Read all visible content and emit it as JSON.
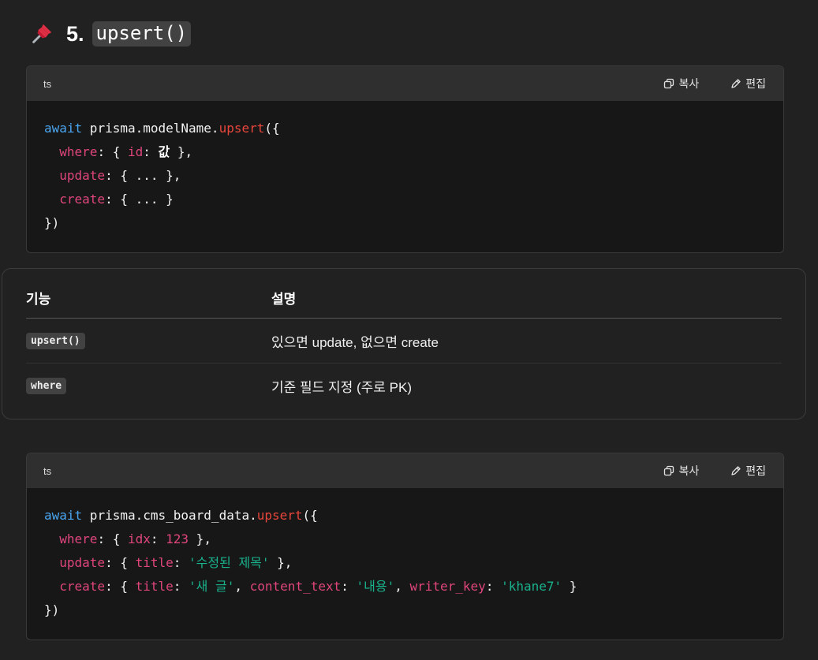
{
  "heading": {
    "number": "5.",
    "code": "upsert()"
  },
  "code_block_1": {
    "language": "ts",
    "copy_label": "복사",
    "edit_label": "편집",
    "lines": [
      [
        {
          "t": "await",
          "c": "kw"
        },
        {
          "t": " prisma.modelName.",
          "c": ""
        },
        {
          "t": "upsert",
          "c": "fn"
        },
        {
          "t": "({",
          "c": ""
        }
      ],
      [
        {
          "t": "  ",
          "c": ""
        },
        {
          "t": "where",
          "c": "prop"
        },
        {
          "t": ": { ",
          "c": ""
        },
        {
          "t": "id",
          "c": "prop"
        },
        {
          "t": ": ",
          "c": ""
        },
        {
          "t": "값",
          "c": "bold-val"
        },
        {
          "t": " },",
          "c": ""
        }
      ],
      [
        {
          "t": "  ",
          "c": ""
        },
        {
          "t": "update",
          "c": "prop"
        },
        {
          "t": ": { ... },",
          "c": ""
        }
      ],
      [
        {
          "t": "  ",
          "c": ""
        },
        {
          "t": "create",
          "c": "prop"
        },
        {
          "t": ": { ... }",
          "c": ""
        }
      ],
      [
        {
          "t": "})",
          "c": ""
        }
      ]
    ]
  },
  "table": {
    "headers": [
      "기능",
      "설명"
    ],
    "rows": [
      {
        "feature": "upsert()",
        "description": "있으면 update, 없으면 create"
      },
      {
        "feature": "where",
        "description": "기준 필드 지정 (주로 PK)"
      }
    ]
  },
  "code_block_2": {
    "language": "ts",
    "copy_label": "복사",
    "edit_label": "편집",
    "lines": [
      [
        {
          "t": "await",
          "c": "kw"
        },
        {
          "t": " prisma.cms_board_data.",
          "c": ""
        },
        {
          "t": "upsert",
          "c": "fn"
        },
        {
          "t": "({",
          "c": ""
        }
      ],
      [
        {
          "t": "  ",
          "c": ""
        },
        {
          "t": "where",
          "c": "prop"
        },
        {
          "t": ": { ",
          "c": ""
        },
        {
          "t": "idx",
          "c": "prop"
        },
        {
          "t": ": ",
          "c": ""
        },
        {
          "t": "123",
          "c": "num-lit"
        },
        {
          "t": " },",
          "c": ""
        }
      ],
      [
        {
          "t": "  ",
          "c": ""
        },
        {
          "t": "update",
          "c": "prop"
        },
        {
          "t": ": { ",
          "c": ""
        },
        {
          "t": "title",
          "c": "prop"
        },
        {
          "t": ": ",
          "c": ""
        },
        {
          "t": "'수정된 제목'",
          "c": "str"
        },
        {
          "t": " },",
          "c": ""
        }
      ],
      [
        {
          "t": "  ",
          "c": ""
        },
        {
          "t": "create",
          "c": "prop"
        },
        {
          "t": ": { ",
          "c": ""
        },
        {
          "t": "title",
          "c": "prop"
        },
        {
          "t": ": ",
          "c": ""
        },
        {
          "t": "'새 글'",
          "c": "str"
        },
        {
          "t": ", ",
          "c": ""
        },
        {
          "t": "content_text",
          "c": "prop"
        },
        {
          "t": ": ",
          "c": ""
        },
        {
          "t": "'내용'",
          "c": "str"
        },
        {
          "t": ", ",
          "c": ""
        },
        {
          "t": "writer_key",
          "c": "prop"
        },
        {
          "t": ": ",
          "c": ""
        },
        {
          "t": "'khane7'",
          "c": "str"
        },
        {
          "t": " }",
          "c": ""
        }
      ],
      [
        {
          "t": "})",
          "c": ""
        }
      ]
    ]
  },
  "icons": {
    "pin": "pushpin-icon",
    "copy": "copy-icon",
    "edit": "pencil-icon"
  },
  "colors": {
    "background": "#212121",
    "code_bg": "#171717",
    "code_header_bg": "#2f2f2f",
    "keyword": "#4aa5f0",
    "function": "#e8463c",
    "property": "#e0467c",
    "string": "#19b28c"
  }
}
